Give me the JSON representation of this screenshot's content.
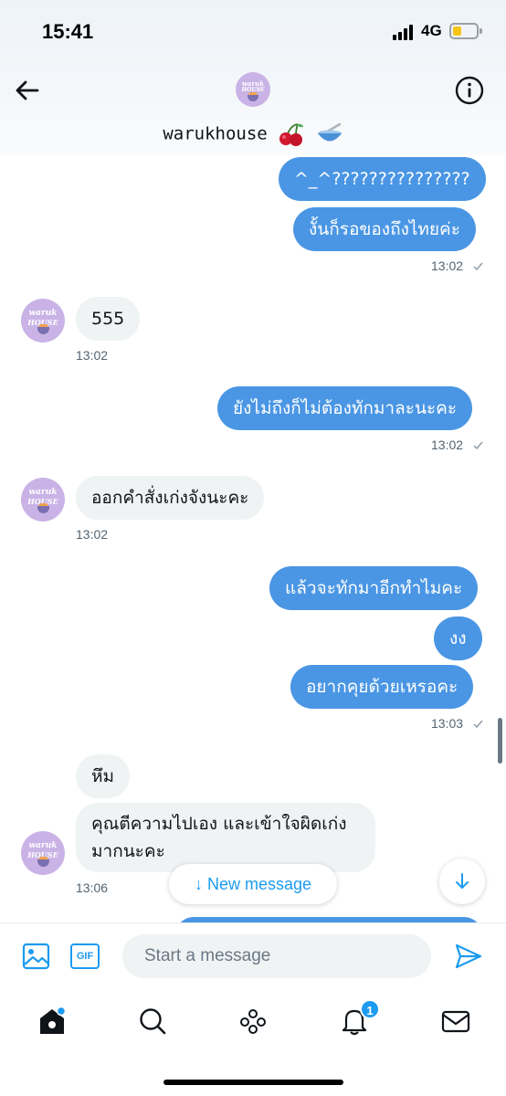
{
  "status_bar": {
    "time": "15:41",
    "network": "4G"
  },
  "header": {
    "name": "warukhouse",
    "name_emojis": [
      "cherry-icon",
      "bowl-icon"
    ],
    "avatar_text_1": "waruk",
    "avatar_text_2": "HOUSE"
  },
  "colors": {
    "outgoing_bubble": "#4a96e4",
    "incoming_bubble": "#eff3f4",
    "accent": "#1d9bf0"
  },
  "messages": [
    {
      "direction": "out",
      "text": "^_^???????????????"
    },
    {
      "direction": "out",
      "text": "งั้นก็รอของถึงไทยค่ะ",
      "time": "13:02",
      "read_check": true
    },
    {
      "direction": "in",
      "text": "555",
      "time": "13:02"
    },
    {
      "direction": "out",
      "text": "ยังไม่ถึงก็ไม่ต้องทักมาละนะคะ",
      "time": "13:02",
      "read_check": true
    },
    {
      "direction": "in",
      "text": "ออกคำสั่งเก่งจังนะคะ",
      "time": "13:02"
    },
    {
      "direction": "out",
      "text": "แล้วจะทักมาอีกทำไมคะ"
    },
    {
      "direction": "out",
      "text": "งง"
    },
    {
      "direction": "out",
      "text": "อยากคุยด้วยเหรอคะ",
      "time": "13:03",
      "read_check": true
    },
    {
      "direction": "in",
      "text": "หึม"
    },
    {
      "direction": "in",
      "text": "คุณตีความไปเอง และเข้าใจผิดเก่งมากนะคะ",
      "time": "13:06"
    }
  ],
  "new_message_button": {
    "label": "↓ New message"
  },
  "composer": {
    "placeholder": "Start a message",
    "gif_label": "GIF"
  },
  "tabbar": {
    "notifications_badge": "1"
  }
}
